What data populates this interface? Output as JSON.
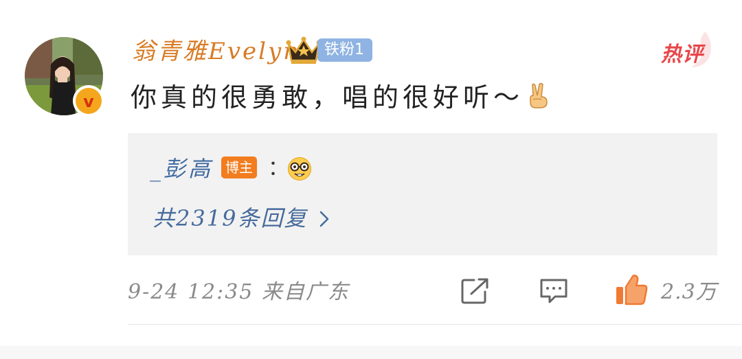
{
  "comment": {
    "username": "翁青雅Evelyn",
    "fan_badge": "铁粉1",
    "hot_tag": "热评",
    "text": "你真的很勇敢，唱的很好听～",
    "verified_mark": "v"
  },
  "reply": {
    "author": "_彭高",
    "author_badge": "博主",
    "colon": "：",
    "count_text": "共2319条回复"
  },
  "footer": {
    "timestamp": "9-24 12:35 来自广东",
    "like_count": "2.3万"
  },
  "icons": {
    "crown": "crown-icon",
    "victory": "victory-hand-icon",
    "nerd": "nerd-face-emoji",
    "share": "share-icon",
    "comment": "comment-icon",
    "like": "thumbs-up-icon",
    "chevron": "chevron-right-icon"
  },
  "colors": {
    "username": "#d87b25",
    "fan_badge_bg": "#8fb3e2",
    "hot_tag": "#e8474a",
    "reply_link": "#3f6aa0",
    "blogger_badge_bg": "#f27d1e",
    "like_icon": "#f07a34",
    "meta_text": "#8a8a8a"
  }
}
